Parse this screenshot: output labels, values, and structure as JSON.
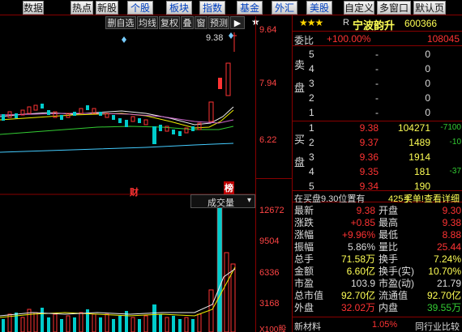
{
  "top_tabs": [
    "数据",
    "热点",
    "新股",
    "个股",
    "板块",
    "指数",
    "基金",
    "外汇",
    "美股",
    "自定义",
    "多窗口",
    "默认页"
  ],
  "toolbar": {
    "buttons": [
      "删自选",
      "均线",
      "复权",
      "叠",
      "窗",
      "预测",
      "▶"
    ],
    "star": "★"
  },
  "price_axis": [
    "9.64",
    "7.94",
    "6.22"
  ],
  "volume_axis": [
    "12672",
    "9504",
    "6336",
    "3168",
    "X100股"
  ],
  "chart": {
    "max_label": "9.38",
    "marker_cai": "财",
    "marker_jing": "榜",
    "volume_title": "成交量"
  },
  "stock": {
    "stars": "★★★",
    "r_flag": "R",
    "name": "宁波韵升",
    "code": "600366"
  },
  "weibi": {
    "label": "委比",
    "pct": "+100.00%",
    "value": "108045"
  },
  "sell_label": "卖盘",
  "buy_label": "买盘",
  "sell_orders": [
    {
      "lvl": "5",
      "price": "-",
      "vol": "0",
      "chg": ""
    },
    {
      "lvl": "4",
      "price": "-",
      "vol": "0",
      "chg": ""
    },
    {
      "lvl": "3",
      "price": "-",
      "vol": "0",
      "chg": ""
    },
    {
      "lvl": "2",
      "price": "-",
      "vol": "0",
      "chg": ""
    },
    {
      "lvl": "1",
      "price": "-",
      "vol": "0",
      "chg": ""
    }
  ],
  "buy_orders": [
    {
      "lvl": "1",
      "price": "9.38",
      "vol": "104271",
      "chg": "-7100"
    },
    {
      "lvl": "2",
      "price": "9.37",
      "vol": "1489",
      "chg": "-10"
    },
    {
      "lvl": "3",
      "price": "9.36",
      "vol": "1914",
      "chg": ""
    },
    {
      "lvl": "4",
      "price": "9.35",
      "vol": "181",
      "chg": "-37"
    },
    {
      "lvl": "5",
      "price": "9.34",
      "vol": "190",
      "chg": ""
    }
  ],
  "highlight": {
    "left": "在买盘9.30位置有",
    "mid": "425手",
    "right": "买单!查看详细"
  },
  "stats": [
    {
      "l1": "最新",
      "v1": "9.38",
      "c1": "red",
      "l2": "开盘",
      "v2": "9.30",
      "c2": "red"
    },
    {
      "l1": "涨跌",
      "v1": "+0.85",
      "c1": "red",
      "l2": "最高",
      "v2": "9.38",
      "c2": "red"
    },
    {
      "l1": "涨幅",
      "v1": "+9.96%",
      "c1": "red",
      "l2": "最低",
      "v2": "8.88",
      "c2": "red"
    },
    {
      "l1": "振幅",
      "v1": "5.86%",
      "c1": "white",
      "l2": "量比",
      "v2": "25.44",
      "c2": "red"
    },
    {
      "l1": "总手",
      "v1": "71.58万",
      "c1": "yellow",
      "l2": "换手",
      "v2": "7.24%",
      "c2": "yellow"
    },
    {
      "l1": "金额",
      "v1": "6.60亿",
      "c1": "yellow",
      "l2": "换手(实)",
      "v2": "10.70%",
      "c2": "yellow"
    },
    {
      "l1": "市盈",
      "v1": "103.9",
      "c1": "white",
      "l2": "市盈(动)",
      "v2": "21.79",
      "c2": "white"
    },
    {
      "l1": "总市值",
      "v1": "92.70亿",
      "c1": "yellow",
      "l2": "流通值",
      "v2": "92.70亿",
      "c2": "yellow"
    },
    {
      "l1": "外盘",
      "v1": "32.02万",
      "c1": "red",
      "l2": "内盘",
      "v2": "39.55万",
      "c2": "green"
    }
  ],
  "bottom": {
    "label": "新材料",
    "pct": "1.05%",
    "right": "同行业比较"
  }
}
